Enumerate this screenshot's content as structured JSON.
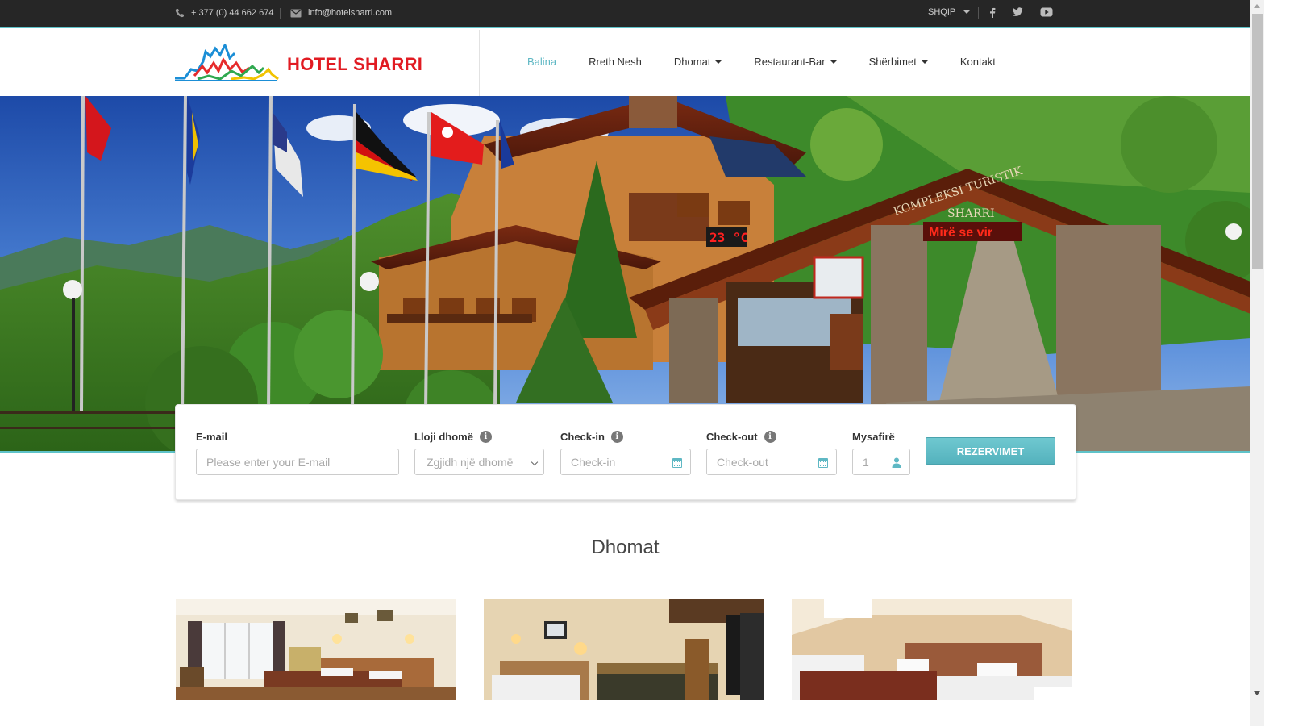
{
  "topbar": {
    "phone": "+ 377 (0) 44 662 674",
    "email": "info@hotelsharri.com",
    "language": "SHQIP",
    "social": [
      "facebook-icon",
      "twitter-icon",
      "youtube-icon"
    ]
  },
  "brand": {
    "name": "HOTEL SHARRI",
    "accent": "#5fb8c4",
    "logo_red": "#e11b22"
  },
  "nav": {
    "items": [
      {
        "label": "Balina",
        "active": true,
        "dropdown": false
      },
      {
        "label": "Rreth Nesh",
        "active": false,
        "dropdown": false
      },
      {
        "label": "Dhomat",
        "active": false,
        "dropdown": true
      },
      {
        "label": "Restaurant-Bar",
        "active": false,
        "dropdown": true
      },
      {
        "label": "Shërbimet",
        "active": false,
        "dropdown": true
      },
      {
        "label": "Kontakt",
        "active": false,
        "dropdown": false
      }
    ]
  },
  "hero": {
    "sign_line1": "KOMPLEKSI TURISTIK",
    "sign_line2": "SHARRI",
    "sign_welcome": "Mirë se vir",
    "temperature": "23 °C"
  },
  "booking": {
    "email_label": "E-mail",
    "email_placeholder": "Please enter your E-mail",
    "room_label": "Lloji dhomë",
    "room_placeholder": "Zgjidh një dhomë",
    "checkin_label": "Check-in",
    "checkin_placeholder": "Check-in",
    "checkout_label": "Check-out",
    "checkout_placeholder": "Check-out",
    "guests_label": "Mysafirë",
    "guests_value": "1",
    "submit_label": "REZERVIMET"
  },
  "rooms": {
    "title": "Dhomat"
  }
}
